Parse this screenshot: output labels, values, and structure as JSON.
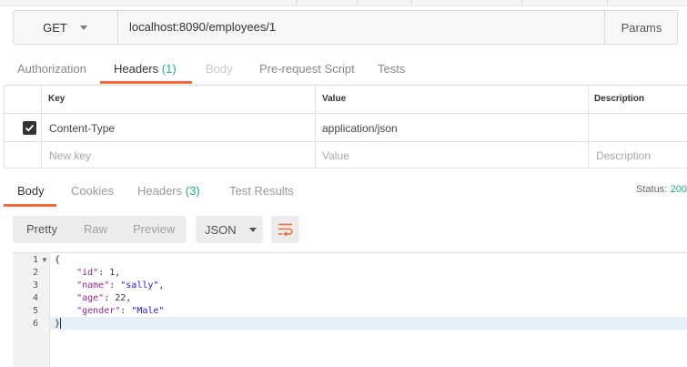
{
  "request": {
    "method": "GET",
    "url": "localhost:8090/employees/1",
    "params_label": "Params"
  },
  "request_tabs": [
    {
      "label": "Authorization"
    },
    {
      "label": "Headers",
      "count": "(1)"
    },
    {
      "label": "Body"
    },
    {
      "label": "Pre-request Script"
    },
    {
      "label": "Tests"
    }
  ],
  "headers_table": {
    "columns": [
      "Key",
      "Value",
      "Description"
    ],
    "rows": [
      {
        "checked": true,
        "key": "Content-Type",
        "value": "application/json",
        "description": ""
      }
    ],
    "new_row": {
      "key_placeholder": "New key",
      "value_placeholder": "Value",
      "description_placeholder": "Description"
    }
  },
  "response_tabs": [
    {
      "label": "Body"
    },
    {
      "label": "Cookies"
    },
    {
      "label": "Headers",
      "count": "(3)"
    },
    {
      "label": "Test Results"
    }
  ],
  "status": {
    "label": "Status:",
    "value": "200"
  },
  "view_modes": [
    "Pretty",
    "Raw",
    "Preview"
  ],
  "format": "JSON",
  "code_lines": [
    "1",
    "2",
    "3",
    "4",
    "5",
    "6"
  ],
  "code": {
    "open": "{",
    "close": "}",
    "fields": [
      {
        "key": "\"id\"",
        "value": "1",
        "trail": ","
      },
      {
        "key": "\"name\"",
        "value": "\"sally\"",
        "trail": ","
      },
      {
        "key": "\"age\"",
        "value": "22",
        "trail": ","
      },
      {
        "key": "\"gender\"",
        "value": "\"Male\"",
        "trail": ""
      }
    ]
  },
  "icons": {
    "method_dropdown": "chevron-down-icon",
    "wrap": "wrap-lines-icon",
    "checkbox": "check-icon",
    "fold": "fold-arrow-icon"
  },
  "colors": {
    "accent": "#f26b3a",
    "count": "#2aa87b",
    "selection": "#e6f0fb"
  }
}
